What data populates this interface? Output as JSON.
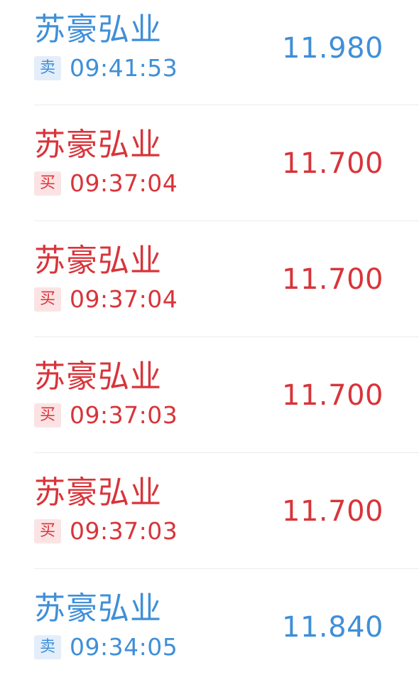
{
  "trades": [
    {
      "name": "苏豪弘业",
      "side": "卖",
      "time": "09:41:53",
      "price": "11.980",
      "type": "sell"
    },
    {
      "name": "苏豪弘业",
      "side": "买",
      "time": "09:37:04",
      "price": "11.700",
      "type": "buy"
    },
    {
      "name": "苏豪弘业",
      "side": "买",
      "time": "09:37:04",
      "price": "11.700",
      "type": "buy"
    },
    {
      "name": "苏豪弘业",
      "side": "买",
      "time": "09:37:03",
      "price": "11.700",
      "type": "buy"
    },
    {
      "name": "苏豪弘业",
      "side": "买",
      "time": "09:37:03",
      "price": "11.700",
      "type": "buy"
    },
    {
      "name": "苏豪弘业",
      "side": "卖",
      "time": "09:34:05",
      "price": "11.840",
      "type": "sell"
    }
  ],
  "colors": {
    "sell": "#3f8fd8",
    "buy": "#d8343a"
  }
}
